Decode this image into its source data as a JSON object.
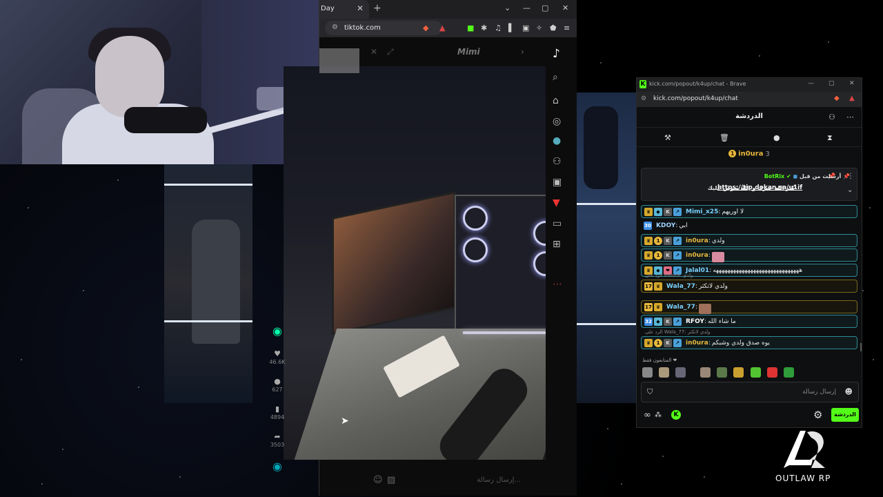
{
  "browser": {
    "tab_title": "Day",
    "tab_close": "✕",
    "new_tab": "+",
    "url": "tiktok.com",
    "window_controls": [
      "⌄",
      "—",
      "▢",
      "✕"
    ]
  },
  "tiktok": {
    "username": "Mimi",
    "stats": {
      "likes": "46.6K",
      "comments": "627",
      "saves": "4894",
      "shares": "3503"
    },
    "comment_placeholder": "إرسال رسالة..."
  },
  "kick": {
    "window_title": "kick.com/popout/k4up/chat - Brave",
    "url": "kick.com/popout/k4up/chat",
    "header_title": "الدردشة",
    "leaderboard": {
      "name": "in0ura",
      "count": "3",
      "rank": "1"
    },
    "pinned": {
      "author_label": "أرسلت من قبل",
      "bot_name": "BotRix",
      "text": "كثر الله خيرك و الله يعوض عليك",
      "link": "https://tip.dokan.sa/u1if"
    },
    "messages": [
      {
        "user": "Mimi_x25",
        "text": "لا اوريهم",
        "user_color": "#7ad0ff",
        "highlight": "hl",
        "badges": [
          "crown",
          "vip",
          "sub",
          "arrow"
        ]
      },
      {
        "user": "KDOY",
        "text": "ابي",
        "user_color": "#9fd3ff",
        "highlight": "",
        "badges": [
          "num2:30"
        ]
      },
      {
        "user": "in0ura",
        "text": "ولدي",
        "user_color": "#e8b83d",
        "highlight": "hl",
        "badges": [
          "crown",
          "coin:1",
          "sub",
          "arrow"
        ]
      },
      {
        "user": "in0ura",
        "text": "",
        "user_color": "#e8b83d",
        "highlight": "hl",
        "badges": [
          "crown",
          "coin:1",
          "sub",
          "arrow"
        ],
        "emote": "#d88ba0"
      },
      {
        "user": "Jalal01",
        "text": "ههههههههههههههههههههههههههههههه",
        "user_color": "#7ad0ff",
        "highlight": "hl",
        "badges": [
          "crown",
          "vip",
          "gift",
          "arrow"
        ]
      },
      {
        "user": "Wala_77",
        "text": "ولدي لاتكثر",
        "user_color": "#7ad0ff",
        "highlight": "hl2",
        "badges": [
          "num:17",
          "crown"
        ],
        "reply": "الرد على in0ura: ولدي"
      },
      {
        "user": "Wala_77",
        "text": "",
        "user_color": "#7ad0ff",
        "highlight": "hl2",
        "badges": [
          "num:17",
          "crown"
        ],
        "emote": "#a0705a"
      },
      {
        "user": "RFOY",
        "text": "ما شاء الله",
        "user_color": "#ffffff",
        "highlight": "hl",
        "badges": [
          "num2:32",
          "vip",
          "sub",
          "arrow"
        ]
      },
      {
        "user": "in0ura",
        "text": "يوه صدق ولدي وشبكم",
        "user_color": "#e8b83d",
        "highlight": "hl",
        "badges": [
          "crown",
          "coin:1",
          "sub",
          "arrow"
        ],
        "reply": "الرد على Wala_77: ولدي لاتكثر"
      }
    ],
    "emotes_title": "المتابعون فقط ❤",
    "input_placeholder": "إرسال رسالة",
    "send_label": "الدردشة"
  },
  "overlay": {
    "brand": "OUTLAW RP"
  }
}
